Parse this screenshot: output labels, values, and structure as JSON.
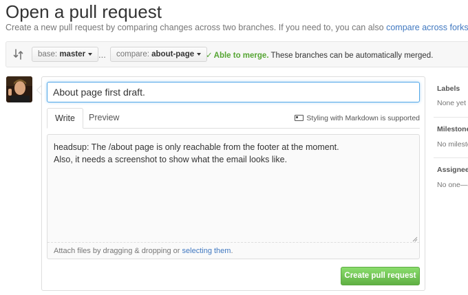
{
  "page": {
    "title": "Open a pull request",
    "subtitle_text": "Create a new pull request by comparing changes across two branches. If you need to, you can also ",
    "subtitle_link": "compare across forks",
    "subtitle_end": "."
  },
  "range": {
    "base_prefix": "base: ",
    "base_branch": "master",
    "ellipsis": "...",
    "compare_prefix": "compare: ",
    "compare_branch": "about-page",
    "merge_status": "Able to merge.",
    "merge_detail": " These branches can be automatically merged."
  },
  "form": {
    "title_value": "About page first draft.",
    "tabs": [
      "Write",
      "Preview"
    ],
    "markdown_hint": "Styling with Markdown is supported",
    "body_lines": [
      "headsup: The /about page is only reachable from the footer at the moment.",
      "Also, it needs a screenshot to show what the email looks like."
    ],
    "attach_text": "Attach files by dragging & dropping or ",
    "attach_link": "selecting them",
    "attach_end": ".",
    "submit_label": "Create pull request"
  },
  "sidebar": {
    "labels_heading": "Labels",
    "labels_value": "None yet",
    "milestone_heading": "Milestone",
    "milestone_value": "No milesto",
    "assignee_heading": "Assignee",
    "assignee_value": "No one—a"
  },
  "colors": {
    "link": "#4078c0",
    "merge_ok": "#55a532",
    "primary_button": "#60b044",
    "focus_border": "#51a7e8"
  }
}
